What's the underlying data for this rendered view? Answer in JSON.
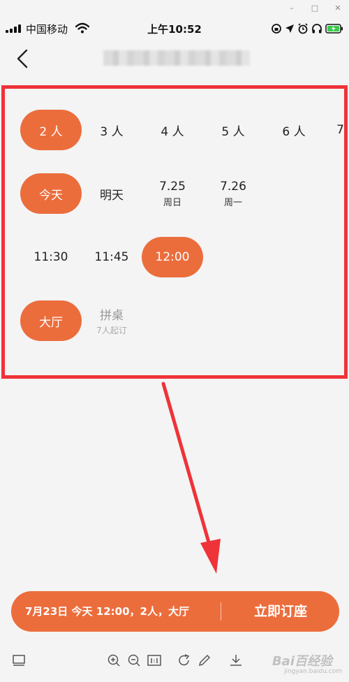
{
  "window": {
    "minimize": "–",
    "maximize": "□",
    "close": "✕"
  },
  "status_bar": {
    "carrier": "中国移动",
    "time": "上午10:52"
  },
  "party_size": {
    "options": [
      "2 人",
      "3 人",
      "4 人",
      "5 人",
      "6 人",
      "7"
    ],
    "selected_index": 0
  },
  "dates": {
    "options": [
      {
        "main": "今天",
        "sub": ""
      },
      {
        "main": "明天",
        "sub": ""
      },
      {
        "main": "7.25",
        "sub": "周日"
      },
      {
        "main": "7.26",
        "sub": "周一"
      }
    ],
    "selected_index": 0
  },
  "times": {
    "options": [
      "11:30",
      "11:45",
      "12:00"
    ],
    "selected_index": 2
  },
  "seating": {
    "options": [
      {
        "main": "大厅",
        "sub": ""
      },
      {
        "main": "拼桌",
        "sub": "7人起订"
      }
    ],
    "selected_index": 0
  },
  "booking": {
    "summary": "7月23日 今天 12:00，2人，大厅",
    "button_label": "立即订座"
  },
  "watermark": {
    "text": "Bai百经验",
    "sub": "jingyan.baidu.com"
  },
  "colors": {
    "accent": "#ec6d3c",
    "highlight": "#ee3339",
    "arrow": "#ee3339"
  }
}
